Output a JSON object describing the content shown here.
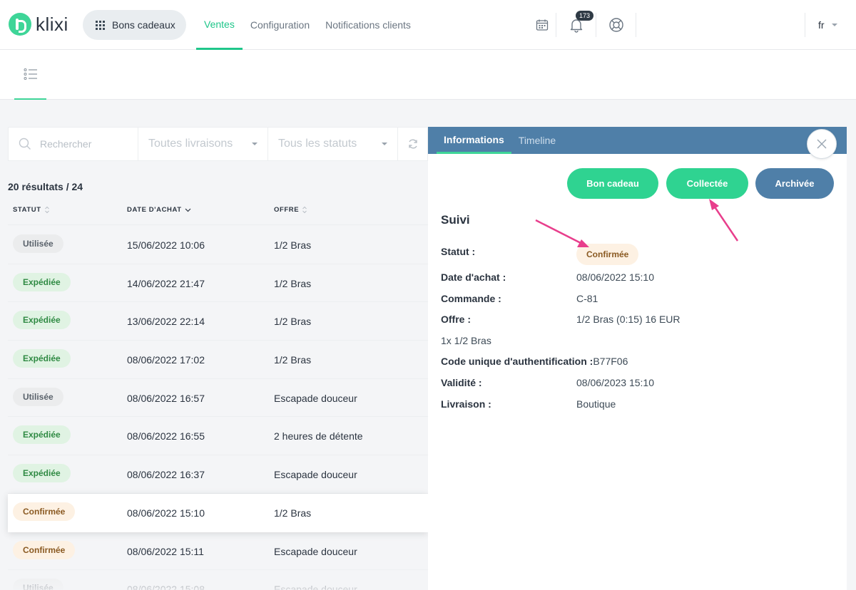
{
  "app": {
    "logo_text": "klixi",
    "module": "Bons cadeaux"
  },
  "nav": [
    {
      "label": "Ventes",
      "active": true
    },
    {
      "label": "Configuration",
      "active": false
    },
    {
      "label": "Notifications clients",
      "active": false
    }
  ],
  "topbar": {
    "notifications_count": "173",
    "language": "fr",
    "icons": [
      "calendar-icon",
      "bell-icon",
      "lifebuoy-icon"
    ]
  },
  "filters": {
    "search_placeholder": "Rechercher",
    "delivery_select": "Toutes livraisons",
    "status_select": "Tous les statuts"
  },
  "results": "20 résultats / 24",
  "table": {
    "headers": [
      "STATUT",
      "DATE D'ACHAT",
      "OFFRE"
    ],
    "rows": [
      {
        "status": "Utilisée",
        "kind": "grey",
        "date": "15/06/2022 10:06",
        "offer": "1/2 Bras"
      },
      {
        "status": "Expédiée",
        "kind": "green",
        "date": "14/06/2022 21:47",
        "offer": "1/2 Bras"
      },
      {
        "status": "Expédiée",
        "kind": "green",
        "date": "13/06/2022 22:14",
        "offer": "1/2 Bras"
      },
      {
        "status": "Expédiée",
        "kind": "green",
        "date": "08/06/2022 17:02",
        "offer": "1/2 Bras"
      },
      {
        "status": "Utilisée",
        "kind": "grey",
        "date": "08/06/2022 16:57",
        "offer": "Escapade douceur"
      },
      {
        "status": "Expédiée",
        "kind": "green",
        "date": "08/06/2022 16:55",
        "offer": "2 heures de détente"
      },
      {
        "status": "Expédiée",
        "kind": "green",
        "date": "08/06/2022 16:37",
        "offer": "Escapade douceur"
      },
      {
        "status": "Confirmée",
        "kind": "orange",
        "date": "08/06/2022 15:10",
        "offer": "1/2 Bras",
        "selected": true
      },
      {
        "status": "Confirmée",
        "kind": "orange",
        "date": "08/06/2022 15:11",
        "offer": "Escapade douceur"
      },
      {
        "status": "Utilisée",
        "kind": "grey",
        "date": "08/06/2022 15:08",
        "offer": "Escapade douceur"
      }
    ]
  },
  "detail": {
    "tabs": [
      "Informations",
      "Timeline"
    ],
    "actions": {
      "gift": "Bon cadeau",
      "collected": "Collectée",
      "archived": "Archivée"
    },
    "section_title": "Suivi",
    "status_label": "Statut :",
    "status_value": "Confirmée",
    "purchase_date_label": "Date d'achat :",
    "purchase_date_value": "08/06/2022 15:10",
    "order_label": "Commande :",
    "order_value": "C-81",
    "offer_label": "Offre :",
    "offer_value": "1/2 Bras (0:15) 16 EUR",
    "line_item": "1x 1/2 Bras",
    "code_label": "Code unique d'authentification :",
    "code_value": "B77F06",
    "validity_label": "Validité :",
    "validity_value": "08/06/2023 15:10",
    "delivery_label": "Livraison :",
    "delivery_value": "Boutique"
  },
  "colors": {
    "accent": "#2fd391",
    "blue": "#4f7fa8",
    "annotation": "#e83e8c"
  }
}
